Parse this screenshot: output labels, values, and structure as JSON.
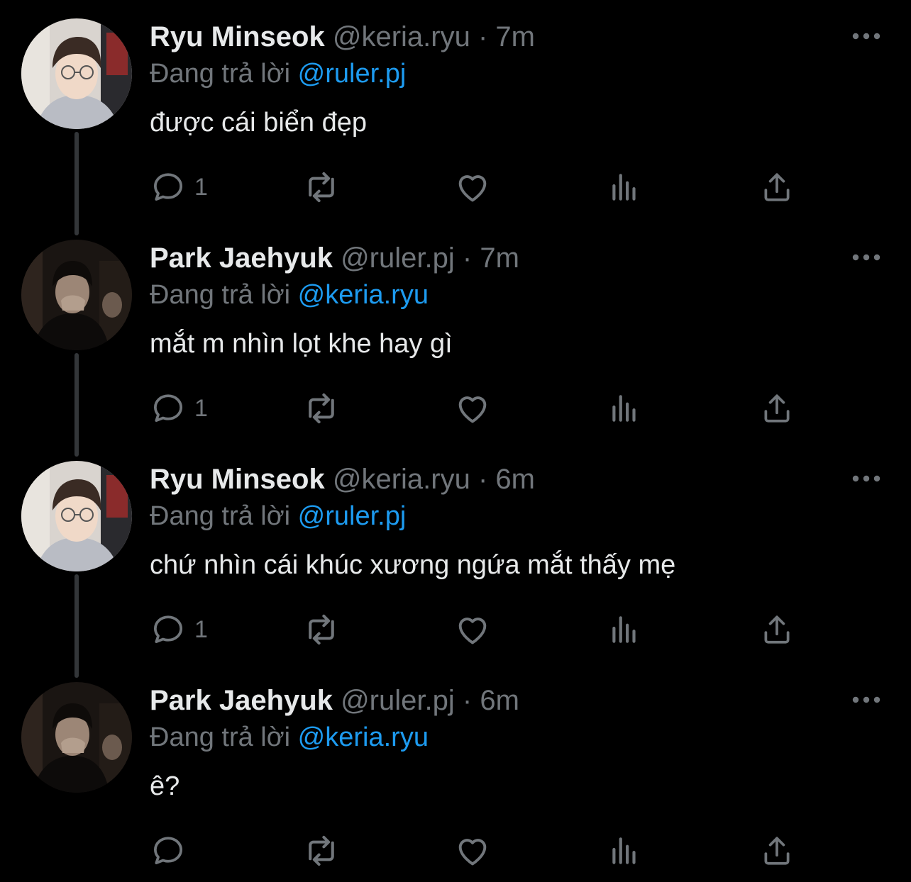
{
  "thread": {
    "tweets": [
      {
        "display_name": "Ryu Minseok",
        "handle": "@keria.ryu",
        "separator": "·",
        "time": "7m",
        "reply_prefix": "Đang trả lời",
        "reply_to": "@ruler.pj",
        "text": "được cái biển đẹp",
        "reply_count": "1",
        "avatar": "keria-avatar"
      },
      {
        "display_name": "Park Jaehyuk",
        "handle": "@ruler.pj",
        "separator": "·",
        "time": "7m",
        "reply_prefix": "Đang trả lời",
        "reply_to": "@keria.ryu",
        "text": "mắt m nhìn lọt khe hay gì",
        "reply_count": "1",
        "avatar": "ruler-avatar"
      },
      {
        "display_name": "Ryu Minseok",
        "handle": "@keria.ryu",
        "separator": "·",
        "time": "6m",
        "reply_prefix": "Đang trả lời",
        "reply_to": "@ruler.pj",
        "text": "chứ nhìn cái khúc xương ngứa mắt thấy mẹ",
        "reply_count": "1",
        "avatar": "keria-avatar"
      },
      {
        "display_name": "Park Jaehyuk",
        "handle": "@ruler.pj",
        "separator": "·",
        "time": "6m",
        "reply_prefix": "Đang trả lời",
        "reply_to": "@keria.ryu",
        "text": "ê?",
        "reply_count": "",
        "avatar": "ruler-avatar"
      }
    ]
  },
  "icons": {
    "reply": "reply-icon",
    "retweet": "retweet-icon",
    "like": "heart-icon",
    "views": "analytics-icon",
    "share": "share-icon",
    "more": "more-options-icon"
  },
  "colors": {
    "background": "#000000",
    "text_primary": "#e7e9ea",
    "text_secondary": "#71767b",
    "link": "#1d9bf0",
    "thread_line": "#333639"
  }
}
